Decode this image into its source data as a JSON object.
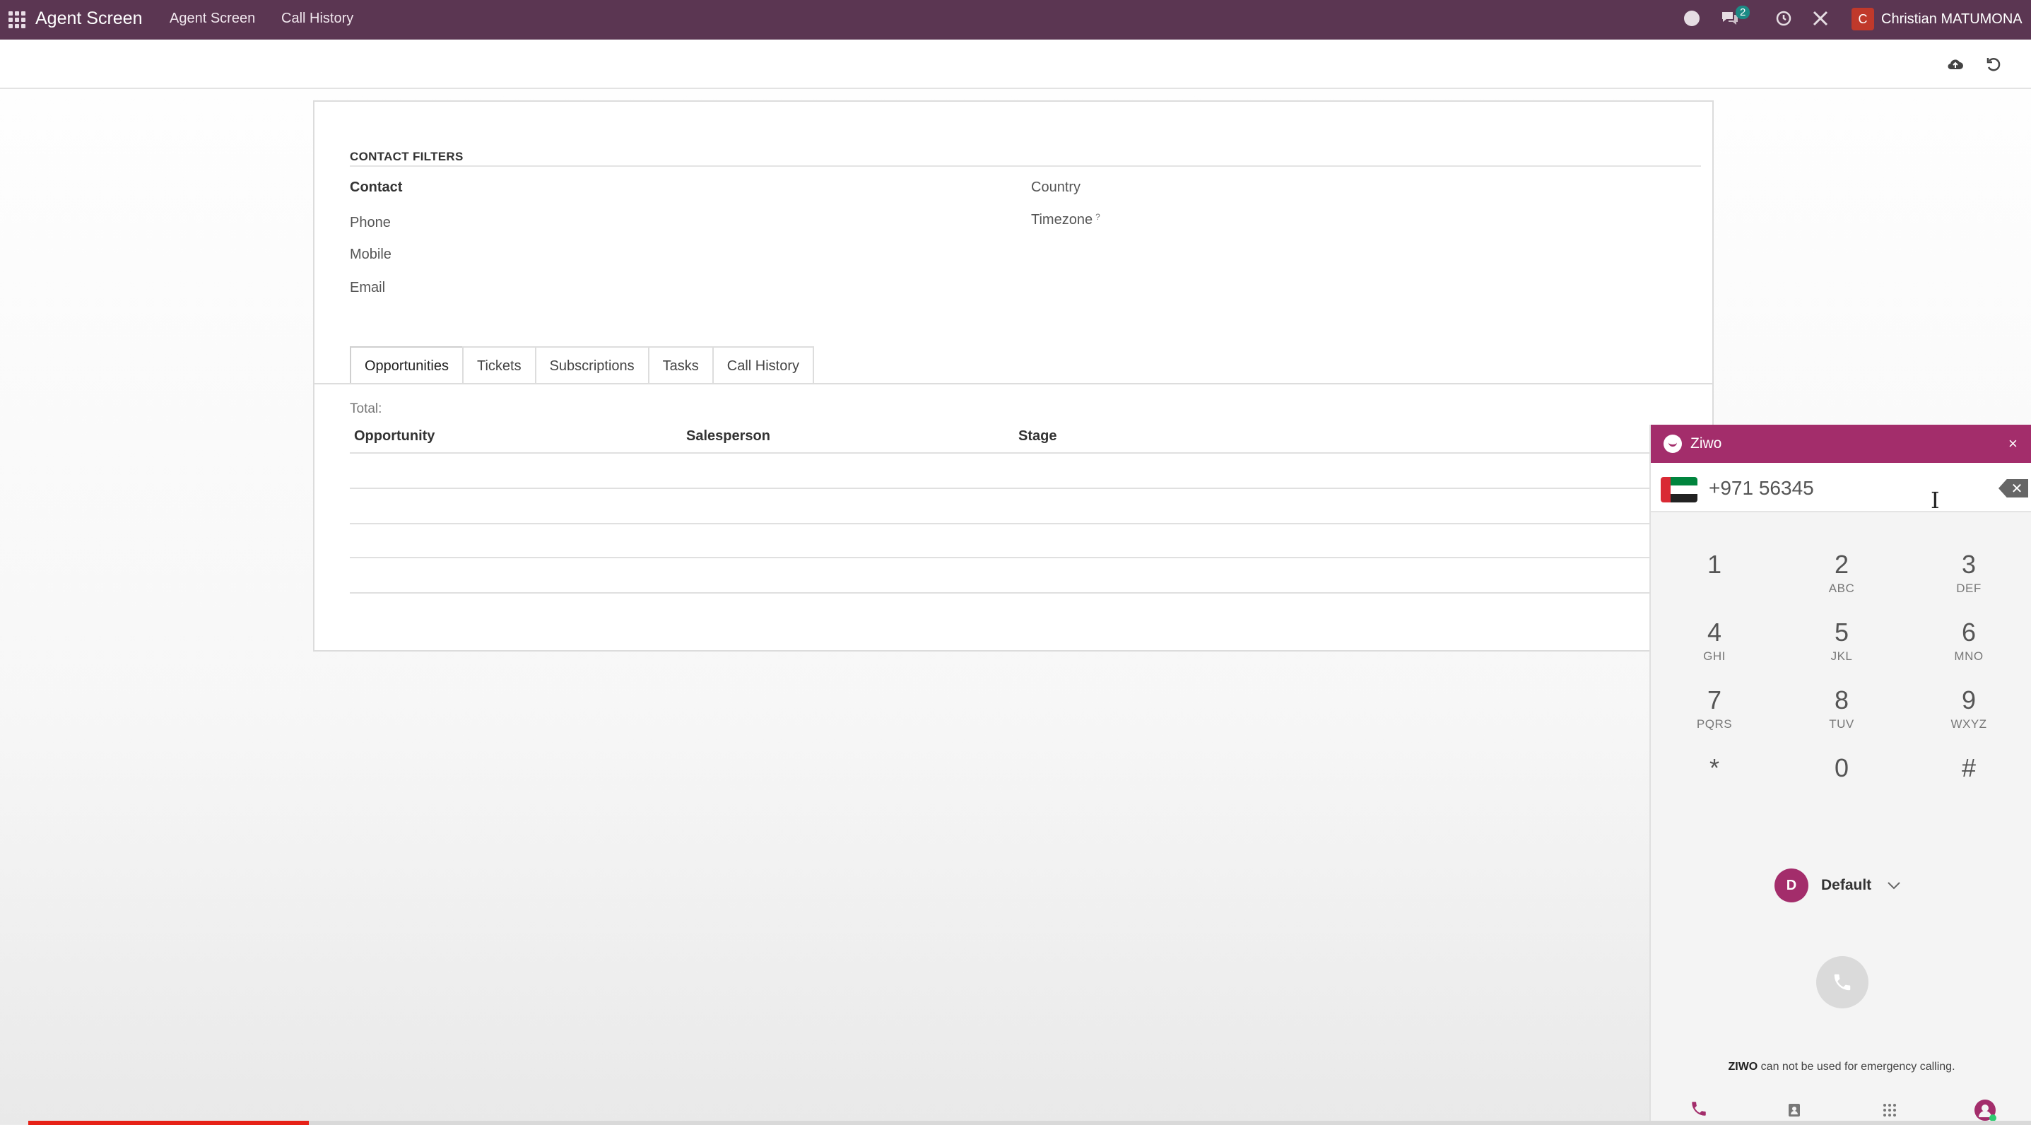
{
  "navbar": {
    "brand": "Agent Screen",
    "items": [
      "Agent Screen",
      "Call History"
    ],
    "messages_badge": "2",
    "user_initial": "C",
    "user_name": "Christian MATUMONA",
    "bg_color": "#5b3652"
  },
  "control_panel": {
    "icons": [
      "cloud-upload-icon",
      "undo-icon"
    ]
  },
  "contact_filters": {
    "title": "CONTACT FILTERS",
    "left_fields": [
      "Contact",
      "Phone",
      "Mobile",
      "Email"
    ],
    "right_fields": [
      "Country",
      "Timezone"
    ],
    "timezone_help": "?"
  },
  "tabs": [
    "Opportunities",
    "Tickets",
    "Subscriptions",
    "Tasks",
    "Call History"
  ],
  "active_tab": "Opportunities",
  "list": {
    "total_label": "Total:",
    "columns": [
      "Opportunity",
      "Salesperson",
      "Stage"
    ]
  },
  "dialer": {
    "title": "Ziwo",
    "close": "×",
    "number": "+971 56345",
    "country_flag": "uae-flag",
    "keys": [
      {
        "digit": "1",
        "letters": ""
      },
      {
        "digit": "2",
        "letters": "ABC"
      },
      {
        "digit": "3",
        "letters": "DEF"
      },
      {
        "digit": "4",
        "letters": "GHI"
      },
      {
        "digit": "5",
        "letters": "JKL"
      },
      {
        "digit": "6",
        "letters": "MNO"
      },
      {
        "digit": "7",
        "letters": "PQRS"
      },
      {
        "digit": "8",
        "letters": "TUV"
      },
      {
        "digit": "9",
        "letters": "WXYZ"
      },
      {
        "digit": "*",
        "letters": ""
      },
      {
        "digit": "0",
        "letters": ""
      },
      {
        "digit": "#",
        "letters": ""
      }
    ],
    "queue_initial": "D",
    "queue_label": "Default",
    "emergency_brand": "ZIWO",
    "emergency_text": " can not be used for emergency calling.",
    "accent_color": "#a32d6b",
    "bottom_tabs": [
      "phone-icon",
      "contacts-icon",
      "keypad-icon",
      "agent-status-icon"
    ]
  },
  "video_progress": 0.14
}
